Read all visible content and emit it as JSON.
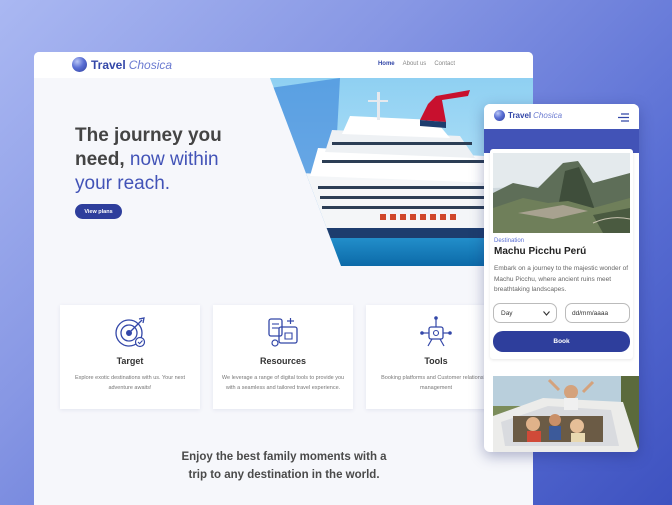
{
  "brand": {
    "name_bold": "Travel",
    "name_italic": "Chosica"
  },
  "nav": {
    "home": "Home",
    "about": "About us",
    "contact": "Contact"
  },
  "hero": {
    "line1": "The journey you",
    "line2a": "need,",
    "line2b": "now within",
    "line3": "your reach.",
    "cta": "View plans"
  },
  "cards": [
    {
      "icon": "target-icon",
      "title": "Target",
      "text": "Explore exotic destinations with us. Your next adventure awaits!"
    },
    {
      "icon": "resources-icon",
      "title": "Resources",
      "text": "We leverage a range of digital tools to provide you with a seamless and tailored travel experience."
    },
    {
      "icon": "tools-icon",
      "title": "Tools",
      "text": "Booking platforms and Customer relationship management"
    }
  ],
  "tagline": {
    "line1": "Enjoy the best family moments with a",
    "line2": "trip to any destination in the world."
  },
  "mobile": {
    "subtitle": "Destination",
    "destination": "Machu Picchu Perú",
    "description": "Embark on a journey to the majestic wonder of Machu Picchu, where ancient ruins meet breathtaking landscapes.",
    "select_value": "Day",
    "date_value": "dd/mm/aaaa",
    "book": "Book"
  },
  "colors": {
    "primary": "#2e3e9c",
    "accent": "#4253b7",
    "funnel": "#c8102e"
  }
}
